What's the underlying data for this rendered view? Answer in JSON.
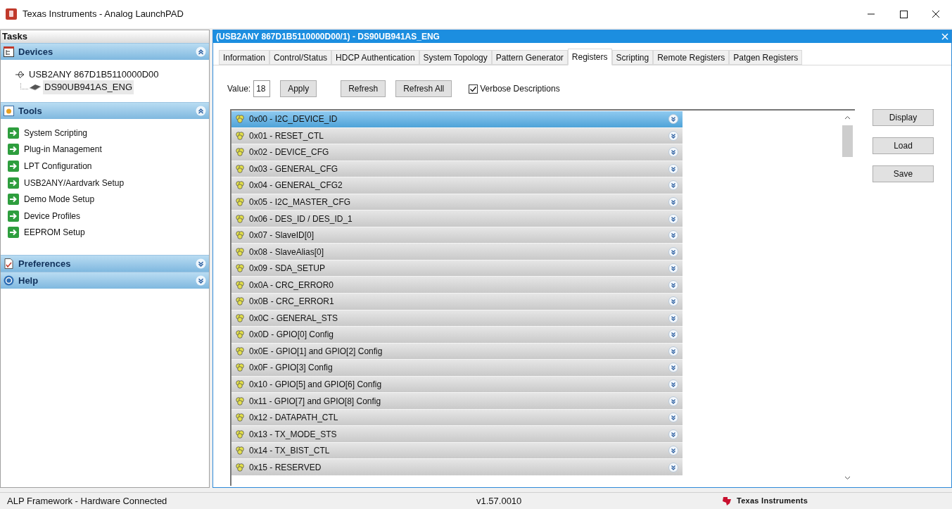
{
  "window": {
    "title": "Texas Instruments - Analog LaunchPAD"
  },
  "sidebar": {
    "heading": "Tasks",
    "sections": [
      {
        "kind": "devices",
        "label": "Devices",
        "expanded": true,
        "tree": [
          {
            "label": "USB2ANY 867D1B5110000D00",
            "children": [
              {
                "label": "DS90UB941AS_ENG",
                "selected": true
              }
            ]
          }
        ]
      },
      {
        "kind": "tools",
        "label": "Tools",
        "expanded": true,
        "items": [
          "System Scripting",
          "Plug-in Management",
          "LPT Configuration",
          "USB2ANY/Aardvark Setup",
          "Demo Mode Setup",
          "Device Profiles",
          "EEPROM Setup"
        ]
      },
      {
        "kind": "preferences",
        "label": "Preferences",
        "expanded": false
      },
      {
        "kind": "help",
        "label": "Help",
        "expanded": false
      }
    ]
  },
  "panel": {
    "title": "(USB2ANY 867D1B5110000D00/1) - DS90UB941AS_ENG",
    "tabs": [
      {
        "label": "Information",
        "selected": false
      },
      {
        "label": "Control/Status",
        "selected": false
      },
      {
        "label": "HDCP Authentication",
        "selected": false
      },
      {
        "label": "System Topology",
        "selected": false
      },
      {
        "label": "Pattern Generator",
        "selected": false
      },
      {
        "label": "Registers",
        "selected": true
      },
      {
        "label": "Scripting",
        "selected": false
      },
      {
        "label": "Remote Registers",
        "selected": false
      },
      {
        "label": "Patgen Registers",
        "selected": false
      }
    ],
    "value_label": "Value:",
    "value": "18",
    "buttons": [
      "Apply",
      "Refresh",
      "Refresh All"
    ],
    "verbose": {
      "label": "Verbose Descriptions",
      "checked": true
    },
    "registers": [
      {
        "label": "0x00 - I2C_DEVICE_ID",
        "selected": true
      },
      {
        "label": "0x01 - RESET_CTL",
        "selected": false
      },
      {
        "label": "0x02 - DEVICE_CFG",
        "selected": false
      },
      {
        "label": "0x03 - GENERAL_CFG",
        "selected": false
      },
      {
        "label": "0x04 - GENERAL_CFG2",
        "selected": false
      },
      {
        "label": "0x05 - I2C_MASTER_CFG",
        "selected": false
      },
      {
        "label": "0x06 - DES_ID / DES_ID_1",
        "selected": false
      },
      {
        "label": "0x07 - SlaveID[0]",
        "selected": false
      },
      {
        "label": "0x08 - SlaveAlias[0]",
        "selected": false
      },
      {
        "label": "0x09 - SDA_SETUP",
        "selected": false
      },
      {
        "label": "0x0A - CRC_ERROR0",
        "selected": false
      },
      {
        "label": "0x0B - CRC_ERROR1",
        "selected": false
      },
      {
        "label": "0x0C - GENERAL_STS",
        "selected": false
      },
      {
        "label": "0x0D - GPIO[0] Config",
        "selected": false
      },
      {
        "label": "0x0E - GPIO[1] and GPIO[2] Config",
        "selected": false
      },
      {
        "label": "0x0F - GPIO[3] Config",
        "selected": false
      },
      {
        "label": "0x10 - GPIO[5] and GPIO[6] Config",
        "selected": false
      },
      {
        "label": "0x11 - GPIO[7] and GPIO[8] Config",
        "selected": false
      },
      {
        "label": "0x12 - DATAPATH_CTL",
        "selected": false
      },
      {
        "label": "0x13 - TX_MODE_STS",
        "selected": false
      },
      {
        "label": "0x14 - TX_BIST_CTL",
        "selected": false
      },
      {
        "label": "0x15 - RESERVED",
        "selected": false
      }
    ],
    "side_buttons": [
      "Display",
      "Load",
      "Save"
    ]
  },
  "status_bar": {
    "status": "ALP Framework - Hardware Connected",
    "version": "v1.57.0010",
    "brand": "Texas Instruments"
  }
}
